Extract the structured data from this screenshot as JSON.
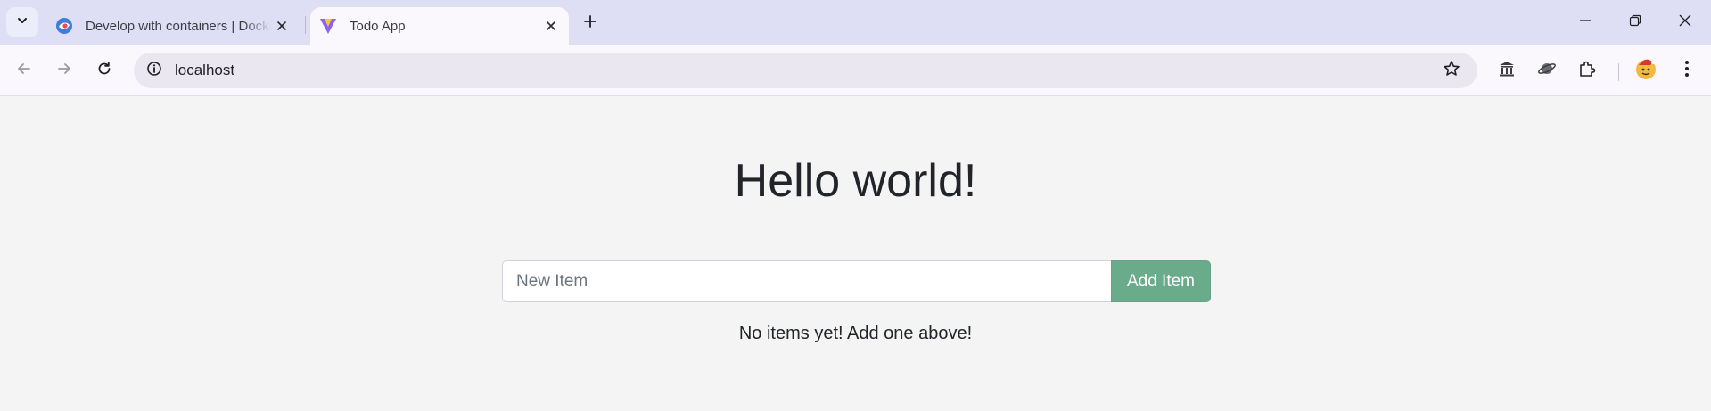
{
  "browser": {
    "tabs": [
      {
        "title": "Develop with containers | Docker",
        "active": false,
        "favicon": "docker-docs-icon"
      },
      {
        "title": "Todo App",
        "active": true,
        "favicon": "vite-icon"
      }
    ],
    "address_bar": {
      "url": "localhost"
    },
    "icons": {
      "tab_search": "chevron-down-icon",
      "new_tab": "plus-icon",
      "minimize": "minimize-icon",
      "restore": "restore-icon",
      "close": "close-icon",
      "back": "back-arrow-icon",
      "forward": "forward-arrow-icon",
      "reload": "reload-icon",
      "site_info": "info-icon",
      "bookmark": "star-icon",
      "extensions": [
        "bank-extension-icon",
        "planet-extension-icon",
        "puzzle-extensions-icon"
      ],
      "profile": "profile-avatar-icon",
      "menu": "more-vert-icon"
    },
    "colors": {
      "tabstrip": "#dedff5",
      "toolbar": "#fbf8fd",
      "omnibox": "#ebe7f1"
    }
  },
  "page": {
    "heading": "Hello world!",
    "new_item": {
      "placeholder": "New Item",
      "value": ""
    },
    "add_button_label": "Add Item",
    "empty_message": "No items yet! Add one above!",
    "colors": {
      "background": "#f4f4f4",
      "button": "#6aab8b",
      "text": "#212529"
    }
  }
}
